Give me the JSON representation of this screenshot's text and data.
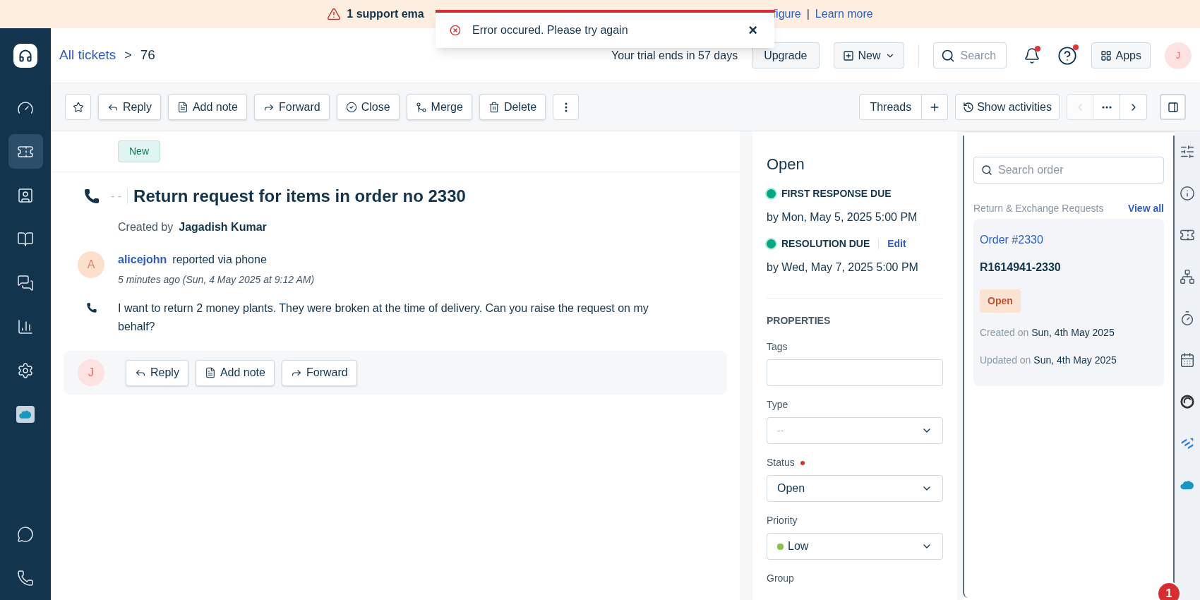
{
  "banner": {
    "text": "1 support ema",
    "link_1": "figure",
    "separator": "|",
    "link_2": "Learn more"
  },
  "toast": {
    "message": "Error occured. Please try again",
    "close": "×"
  },
  "header": {
    "breadcrumb_link": "All tickets",
    "breadcrumb_sep": ">",
    "ticket_no": "76",
    "trial": "Your trial ends in 57 days",
    "upgrade": "Upgrade",
    "new": "New",
    "search_placeholder": "Search",
    "apps": "Apps",
    "avatar": "J"
  },
  "sidebar": {
    "items": [
      {
        "kind": "dashboard",
        "selected": false
      },
      {
        "kind": "tickets",
        "selected": true
      },
      {
        "kind": "contacts",
        "selected": false
      },
      {
        "kind": "knowledge",
        "selected": false
      },
      {
        "kind": "conversations",
        "selected": false
      },
      {
        "kind": "reports",
        "selected": false
      },
      {
        "kind": "settings",
        "selected": false
      },
      {
        "kind": "cloud-app",
        "selected": false
      }
    ],
    "bottom": [
      {
        "kind": "chat"
      },
      {
        "kind": "phone"
      }
    ]
  },
  "toolbar": {
    "left": [
      {
        "kind": "reply",
        "label": "Reply"
      },
      {
        "kind": "note",
        "label": "Add note"
      },
      {
        "kind": "forward",
        "label": "Forward"
      },
      {
        "kind": "close",
        "label": "Close"
      },
      {
        "kind": "merge",
        "label": "Merge"
      },
      {
        "kind": "delete",
        "label": "Delete"
      }
    ],
    "threads": "Threads",
    "activities": "Show activities",
    "nav": [
      {
        "kind": "prev",
        "disabled": true
      },
      {
        "kind": "more",
        "disabled": false
      },
      {
        "kind": "next",
        "disabled": false
      }
    ]
  },
  "ticket": {
    "badge": "New",
    "dash": "- -",
    "title": "Return request for items in order no 2330",
    "created_label": "Created by",
    "created_by": "Jagadish Kumar",
    "message": {
      "avatar": "A",
      "author": "alicejohn",
      "action": "reported via phone",
      "time": "5 minutes ago (Sun, 4 May 2025 at 9:12 AM)",
      "body": "I want to return 2 money plants. They were broken at the time of delivery. Can you raise the request on my behalf?"
    },
    "reply_bar": {
      "avatar": "J",
      "buttons": [
        {
          "kind": "reply",
          "label": "Reply"
        },
        {
          "kind": "note",
          "label": "Add note"
        },
        {
          "kind": "forward",
          "label": "Forward"
        }
      ]
    }
  },
  "properties": {
    "status": "Open",
    "sla": [
      {
        "label": "FIRST RESPONSE DUE",
        "due": "by Mon, May 5, 2025 5:00 PM"
      },
      {
        "label": "RESOLUTION DUE",
        "edit": "Edit",
        "due": "by Wed, May 7, 2025 5:00 PM"
      }
    ],
    "heading": "PROPERTIES",
    "fields": [
      {
        "kind": "text",
        "label": "Tags",
        "required": false
      },
      {
        "kind": "select",
        "label": "Type",
        "placeholder": "--",
        "required": false
      },
      {
        "kind": "select",
        "label": "Status",
        "value": "Open",
        "required": true
      },
      {
        "kind": "select",
        "label": "Priority",
        "value": "Low",
        "color": "#8bc34a",
        "required": false
      },
      {
        "kind": "label",
        "label": "Group",
        "required": false
      }
    ]
  },
  "order_panel": {
    "search_placeholder": "Search order",
    "section": "Return & Exchange Requests",
    "view_all": "View all",
    "order": {
      "title": "Order #2330",
      "id": "R1614941-2330",
      "status": "Open",
      "created_label": "Created on",
      "created": "Sun, 4th May 2025",
      "updated_label": "Updated on",
      "updated": "Sun, 4th May 2025"
    }
  },
  "right_strip": [
    {
      "kind": "sliders"
    },
    {
      "kind": "info"
    },
    {
      "kind": "ticket"
    },
    {
      "kind": "network"
    },
    {
      "kind": "timer"
    },
    {
      "kind": "calendar"
    },
    {
      "kind": "ring-app"
    },
    {
      "kind": "arrows-app"
    },
    {
      "kind": "cloud-app"
    }
  ],
  "notification_badge": "1"
}
